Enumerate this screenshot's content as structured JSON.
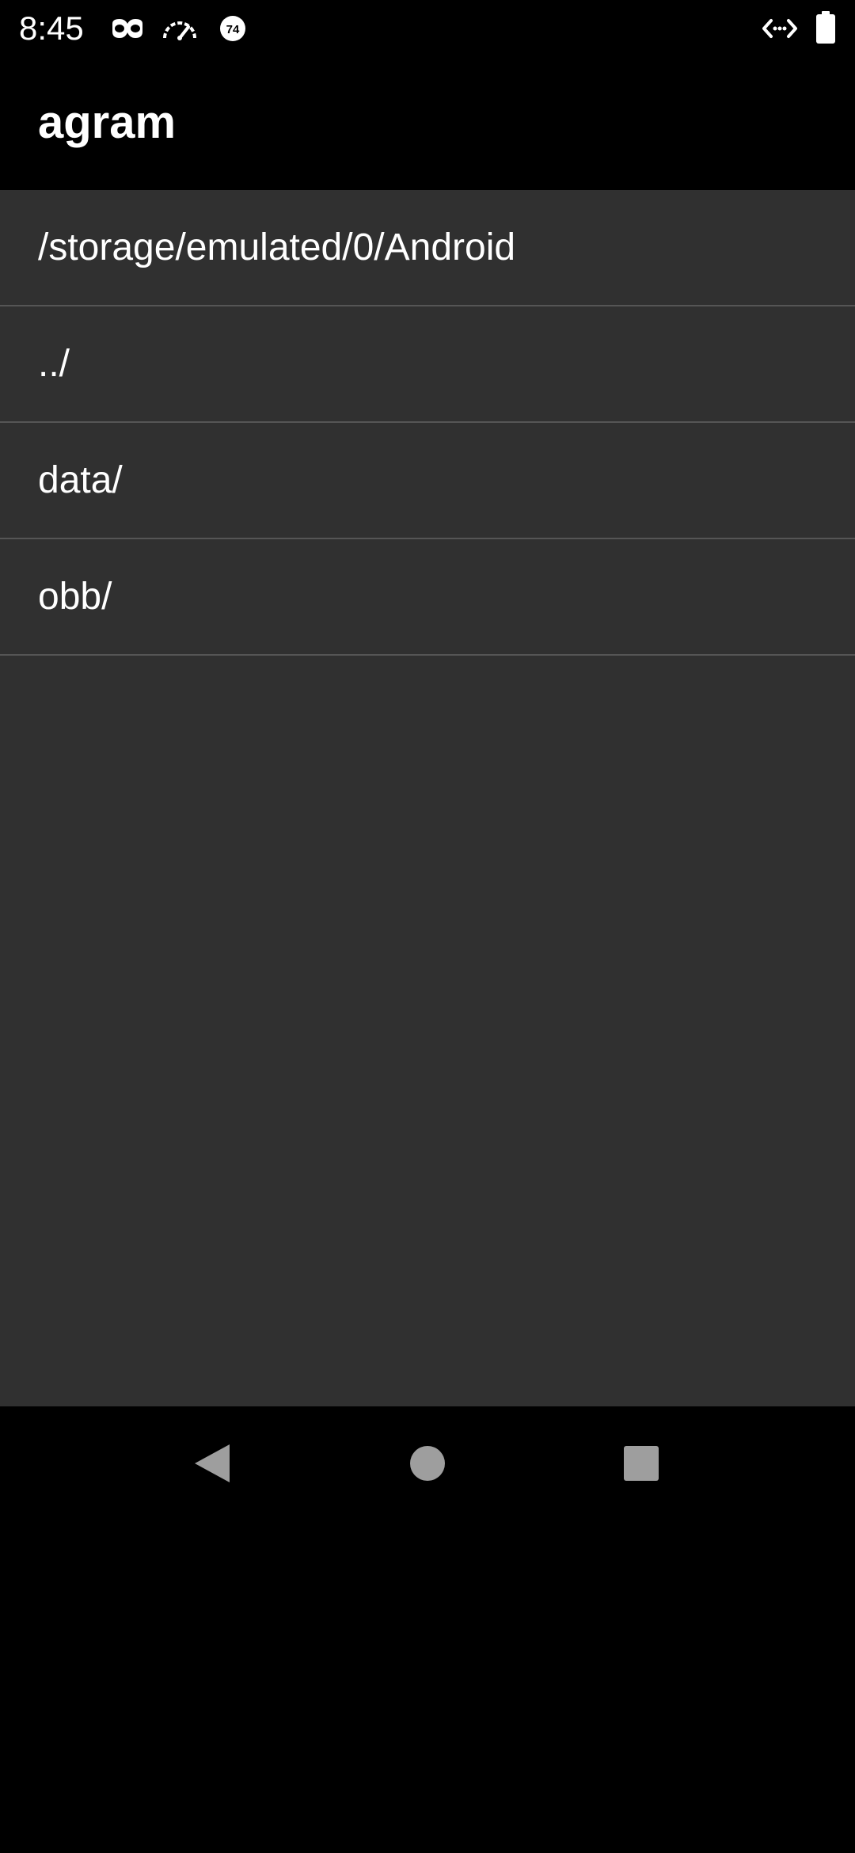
{
  "status_bar": {
    "time": "8:45",
    "left_icons": [
      "incognito-icon",
      "speedometer-icon",
      "notification-badge-icon"
    ],
    "badge_text": "74",
    "right_icons": [
      "code-arrows-icon",
      "battery-icon"
    ]
  },
  "app_bar": {
    "title": "agram"
  },
  "file_list": {
    "items": [
      {
        "label": "/storage/emulated/0/Android"
      },
      {
        "label": "../"
      },
      {
        "label": "data/"
      },
      {
        "label": "obb/"
      }
    ]
  },
  "nav_bar": {
    "buttons": [
      "back-icon",
      "home-icon",
      "recents-icon"
    ]
  },
  "colors": {
    "background": "#000000",
    "content_background": "#303030",
    "divider": "#555555",
    "text": "#ffffff",
    "nav_icon": "#9e9e9e"
  }
}
